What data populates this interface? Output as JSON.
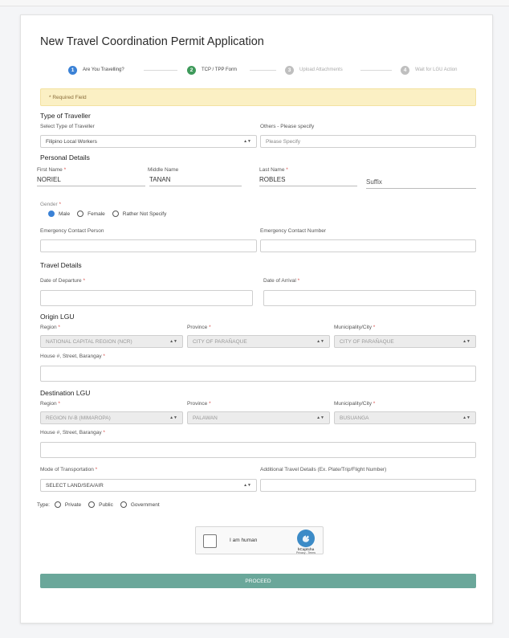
{
  "form": {
    "title": "New Travel Coordination Permit Application",
    "steps": [
      {
        "num": "1",
        "label": "Are You Travelling?",
        "color": "#3b82d6",
        "label_color": "#444"
      },
      {
        "num": "2",
        "label": "TCP / TPP Form",
        "color": "#3f9a5b",
        "label_color": "#444"
      },
      {
        "num": "3",
        "label": "Upload Attachments",
        "color": "#bfbfbf",
        "label_color": "#aaa"
      },
      {
        "num": "4",
        "label": "Wait for LGU Action",
        "color": "#bfbfbf",
        "label_color": "#aaa"
      }
    ],
    "required_note": "* Required Field",
    "type_of_traveller": {
      "heading": "Type of Traveller",
      "select_label": "Select Type of Traveller",
      "select_value": "Filipino Local Workers",
      "others_label": "Others - Please specify",
      "others_placeholder": "Please Specify"
    },
    "personal_details": {
      "heading": "Personal Details",
      "first_name_label": "First Name",
      "first_name": "NORIEL",
      "middle_name_label": "Middle Name",
      "middle_name": "TANAN",
      "last_name_label": "Last Name",
      "last_name": "ROBLES",
      "suffix_placeholder": "Suffix",
      "gender_label": "Gender",
      "gender_options": [
        "Male",
        "Female",
        "Rather Not Specify"
      ],
      "gender_selected": "Male",
      "emergency_person_label": "Emergency Contact Person",
      "emergency_number_label": "Emergency Contact Number"
    },
    "travel_details": {
      "heading": "Travel Details",
      "departure_label": "Date of Departure",
      "arrival_label": "Date of Arrival"
    },
    "origin": {
      "heading": "Origin LGU",
      "region_label": "Region",
      "region": "NATIONAL CAPITAL REGION (NCR)",
      "province_label": "Province",
      "province": "CITY OF PARAÑAQUE",
      "city_label": "Municipality/City",
      "city": "CITY OF PARAÑAQUE",
      "address_label": "House #, Street, Barangay"
    },
    "destination": {
      "heading": "Destination LGU",
      "region_label": "Region",
      "region": "REGION IV-B (MIMAROPA)",
      "province_label": "Province",
      "province": "PALAWAN",
      "city_label": "Municipality/City",
      "city": "BUSUANGA",
      "address_label": "House #, Street, Barangay"
    },
    "transport": {
      "mode_label": "Mode of Transportation",
      "mode_value": "SELECT LAND/SEA/AIR",
      "additional_label": "Additional Travel Details (Ex. Plate/Trip/Flight Number)",
      "type_label": "Type:",
      "type_options": [
        "Private",
        "Public",
        "Government"
      ]
    },
    "captcha": {
      "label": "I am human",
      "brand": "hCaptcha",
      "links": "Privacy - Terms"
    },
    "proceed_label": "PROCEED"
  }
}
